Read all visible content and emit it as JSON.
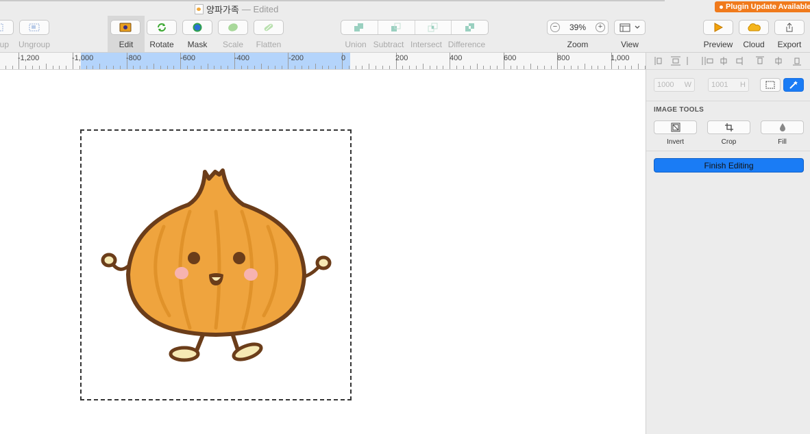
{
  "window": {
    "title": "양파가족",
    "edited_suffix": "— Edited",
    "plugin_badge": "Plugin Update Available"
  },
  "toolbar": {
    "group_partial": "up",
    "ungroup": "Ungroup",
    "edit": "Edit",
    "rotate": "Rotate",
    "mask": "Mask",
    "scale": "Scale",
    "flatten": "Flatten",
    "union": "Union",
    "subtract": "Subtract",
    "intersect": "Intersect",
    "difference": "Difference",
    "zoom_label": "Zoom",
    "zoom_value": "39%",
    "zoom_minus": "−",
    "zoom_plus": "+",
    "view": "View",
    "preview": "Preview",
    "cloud": "Cloud",
    "export": "Export"
  },
  "ruler": {
    "labels": [
      "-1,200",
      "-1,000",
      "-800",
      "-600",
      "-400",
      "-200",
      "0",
      "200",
      "400",
      "600",
      "800",
      "1,000"
    ]
  },
  "inspector": {
    "width_value": "1000",
    "width_unit": "W",
    "height_value": "1001",
    "height_unit": "H",
    "section_title": "IMAGE TOOLS",
    "invert": "Invert",
    "crop": "Crop",
    "fill": "Fill",
    "finish_editing": "Finish Editing"
  },
  "colors": {
    "accent": "#1a7cf5",
    "plugin_badge": "#f07a1c",
    "ruler_selection": "#b4d4fb",
    "onion_body": "#efa43e",
    "onion_outline": "#6b3d1a"
  }
}
